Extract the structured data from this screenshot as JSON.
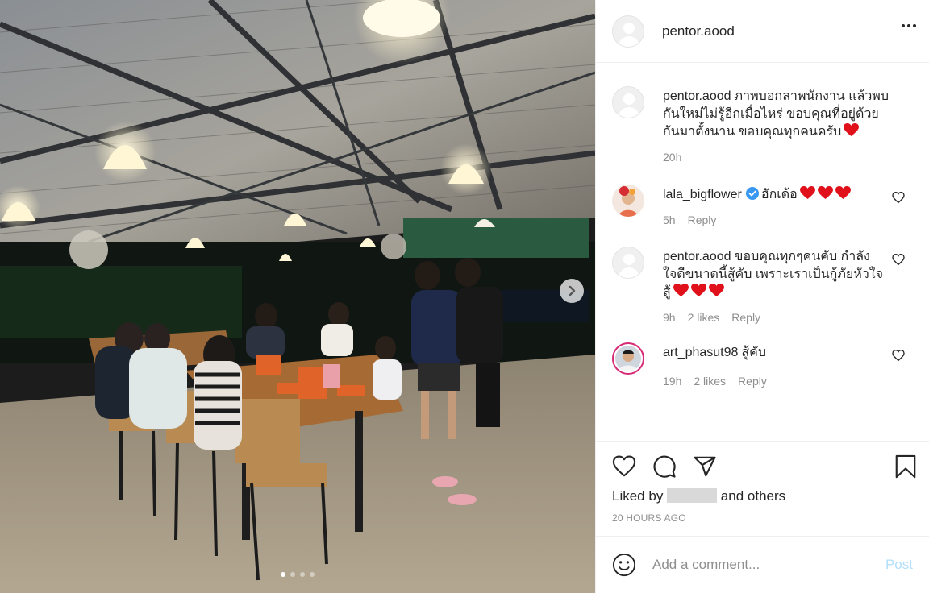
{
  "post": {
    "author": "pentor.aood",
    "more_icon": "more-horizontal-icon",
    "carousel": {
      "slide_count": 4,
      "active_slide": 1,
      "next_icon": "chevron-right-icon"
    }
  },
  "comments": [
    {
      "user": "pentor.aood",
      "text": "ภาพบอกลาพนักงาน แล้วพบกันใหม่ไม่รู้อีกเมื่อไหร่ ขอบคุณที่อยู่ด้วยกันมาตั้งนาน ขอบคุณทุกคนครับ",
      "hearts": 1,
      "time": "20h",
      "likes": "",
      "reply": "",
      "is_caption": true
    },
    {
      "user": "lala_bigflower",
      "verified": true,
      "text": "ฮักเด้อ",
      "hearts": 3,
      "time": "5h",
      "likes": "",
      "reply": "Reply"
    },
    {
      "user": "pentor.aood",
      "text": "ขอบคุณทุกๆคนคับ กำลังใจดีขนาดนี้สู้คับ เพราะเราเป็นกู้ภัยหัวใจสู้",
      "hearts": 3,
      "time": "9h",
      "likes": "2 likes",
      "reply": "Reply"
    },
    {
      "user": "art_phasut98",
      "text": "สู้คับ",
      "hearts": 0,
      "time": "19h",
      "likes": "2 likes",
      "reply": "Reply"
    }
  ],
  "actions": {
    "like_icon": "heart-outline-icon",
    "comment_icon": "comment-bubble-icon",
    "share_icon": "paper-plane-icon",
    "save_icon": "bookmark-icon"
  },
  "liked_by": {
    "prefix": "Liked by",
    "middle": "and",
    "others": "others"
  },
  "time_ago": "20 HOURS AGO",
  "add_comment": {
    "placeholder": "Add a comment...",
    "post_label": "Post"
  },
  "colors": {
    "heart_red": "#ed4956",
    "verified_blue": "#3897f0",
    "post_disabled": "#b2dffc",
    "meta_gray": "#8e8e8e"
  }
}
